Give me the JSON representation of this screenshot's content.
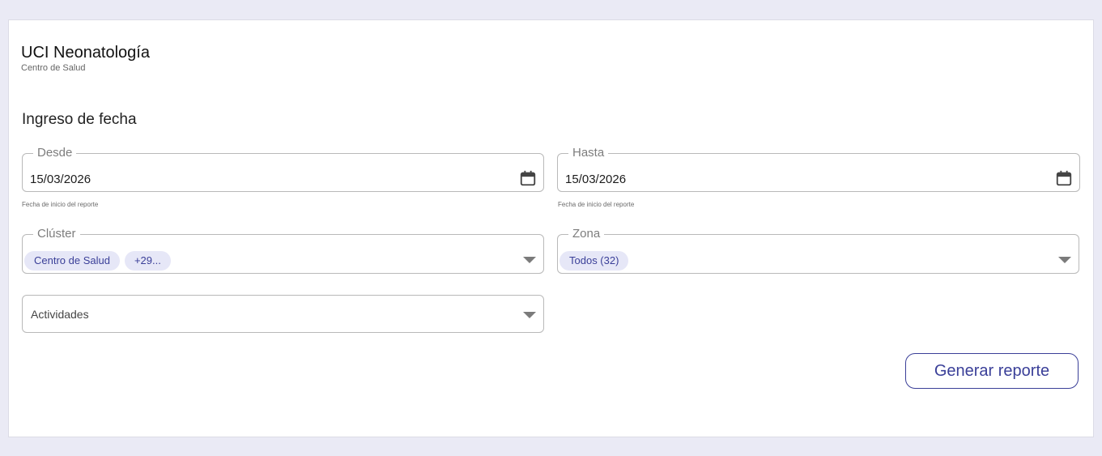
{
  "header": {
    "title": "UCI Neonatología",
    "subtitle": "Centro de Salud"
  },
  "section": {
    "title": "Ingreso de fecha"
  },
  "date_from": {
    "label": "Desde",
    "value": "15/03/2026",
    "helper": "Fecha de inicio del reporte",
    "icon": "calendar-icon"
  },
  "date_to": {
    "label": "Hasta",
    "value": "15/03/2026",
    "helper": "Fecha de inicio del reporte",
    "icon": "calendar-icon"
  },
  "cluster": {
    "label": "Clúster",
    "chips": [
      "Centro de Salud",
      "+29..."
    ],
    "icon": "chevron-down-icon"
  },
  "zone": {
    "label": "Zona",
    "chips": [
      "Todos (32)"
    ],
    "icon": "chevron-down-icon"
  },
  "activities": {
    "placeholder": "Actividades",
    "icon": "chevron-down-icon"
  },
  "actions": {
    "generate_label": "Generar reporte"
  },
  "colors": {
    "background": "#eaeaf5",
    "accent": "#3a3f98",
    "chip_background": "#e6e7f7",
    "border": "#b9b9b9"
  }
}
